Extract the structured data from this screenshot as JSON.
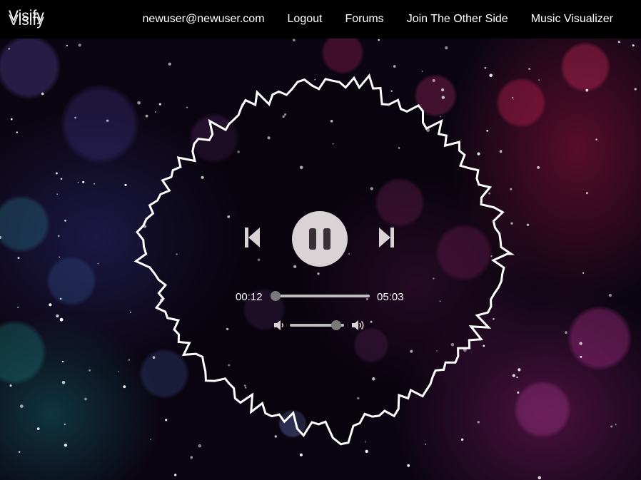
{
  "navbar": {
    "brand": "Visify",
    "links": [
      {
        "label": "newuser@newuser.com"
      },
      {
        "label": "Logout"
      },
      {
        "label": "Forums"
      },
      {
        "label": "Join The Other Side"
      },
      {
        "label": "Music Visualizer"
      }
    ]
  },
  "player": {
    "current_time": "00:12",
    "duration": "05:03",
    "progress": 0.04,
    "volume": 0.85,
    "state": "playing",
    "icons": {
      "previous": "skip-previous-icon",
      "pause": "pause-icon",
      "next": "skip-next-icon",
      "volume_low": "volume-low-icon",
      "volume_high": "volume-high-icon"
    }
  },
  "colors": {
    "navbar_bg": "#000000",
    "control_fill": "#d9d3d6",
    "waveform": "#ffffff"
  }
}
